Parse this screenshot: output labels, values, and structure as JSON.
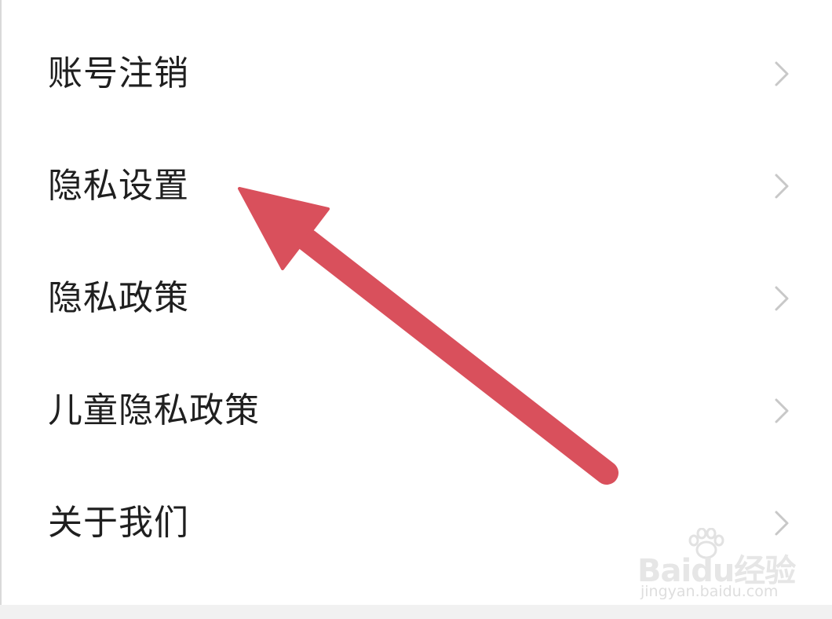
{
  "menu": {
    "items": [
      {
        "label": "账号注销",
        "chevron": "chevron-right-icon"
      },
      {
        "label": "隐私设置",
        "chevron": "chevron-right-icon"
      },
      {
        "label": "隐私政策",
        "chevron": "chevron-right-icon"
      },
      {
        "label": "儿童隐私政策",
        "chevron": "chevron-right-icon"
      },
      {
        "label": "关于我们",
        "chevron": "chevron-right-icon"
      }
    ]
  },
  "annotation": {
    "icon": "arrow-icon",
    "color": "#d9505c",
    "points_to": "隐私设置"
  },
  "watermark": {
    "logo": "Baidu经验",
    "url": "jingyan.baidu.com"
  },
  "colors": {
    "text": "#1f1f1f",
    "chevron": "#c8c8c8",
    "background": "#ffffff",
    "arrow": "#d9505c"
  }
}
